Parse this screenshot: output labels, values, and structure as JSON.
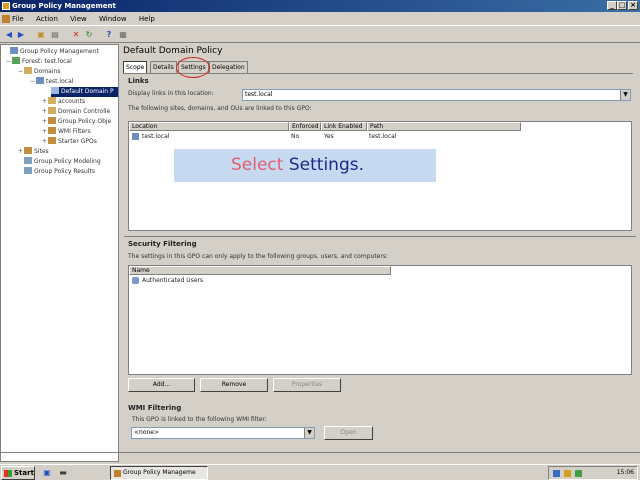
{
  "window": {
    "title": "Group Policy Management"
  },
  "menu": [
    "File",
    "Action",
    "View",
    "Window",
    "Help"
  ],
  "tree": [
    {
      "label": "Group Policy Management",
      "indent": 0,
      "expander": ""
    },
    {
      "label": "Forest: test.local",
      "indent": 1,
      "expander": "−"
    },
    {
      "label": "Domains",
      "indent": 2,
      "expander": "−"
    },
    {
      "label": "test.local",
      "indent": 3,
      "expander": "−"
    },
    {
      "label": "Default Domain P",
      "indent": 4,
      "expander": "",
      "selected": true
    },
    {
      "label": "accounts",
      "indent": 4,
      "expander": "+"
    },
    {
      "label": "Domain Controlle",
      "indent": 4,
      "expander": "+"
    },
    {
      "label": "Group Policy Obje",
      "indent": 4,
      "expander": "+"
    },
    {
      "label": "WMI Filters",
      "indent": 4,
      "expander": "+"
    },
    {
      "label": "Starter GPOs",
      "indent": 4,
      "expander": "+"
    },
    {
      "label": "Sites",
      "indent": 2,
      "expander": "+"
    },
    {
      "label": "Group Policy Modeling",
      "indent": 1,
      "expander": ""
    },
    {
      "label": "Group Policy Results",
      "indent": 1,
      "expander": ""
    }
  ],
  "details": {
    "title": "Default Domain Policy",
    "tabs": [
      "Scope",
      "Details",
      "Settings",
      "Delegation"
    ],
    "links": {
      "heading": "Links",
      "display_label": "Display links in this location:",
      "location_value": "test.local",
      "info": "The following sites, domains, and OUs are linked to this GPO:",
      "columns": [
        "Location",
        "Enforced",
        "Link Enabled",
        "Path"
      ],
      "rows": [
        {
          "location": "test.local",
          "enforced": "No",
          "link_enabled": "Yes",
          "path": "test.local"
        }
      ]
    },
    "security": {
      "heading": "Security Filtering",
      "info": "The settings in this GPO can only apply to the following groups, users, and computers:",
      "column": "Name",
      "rows": [
        "Authenticated Users"
      ],
      "buttons": [
        "Add...",
        "Remove",
        "Properties"
      ]
    },
    "wmi": {
      "heading": "WMI Filtering",
      "info": "This GPO is linked to the following WMI filter:",
      "value": "<none>",
      "button": "Open"
    }
  },
  "callout": {
    "word1": "Select",
    "word2": "Settings",
    "dot": "."
  },
  "taskbar": {
    "start": "Start",
    "task": "Group Policy Manageme",
    "clock": "15:06"
  }
}
